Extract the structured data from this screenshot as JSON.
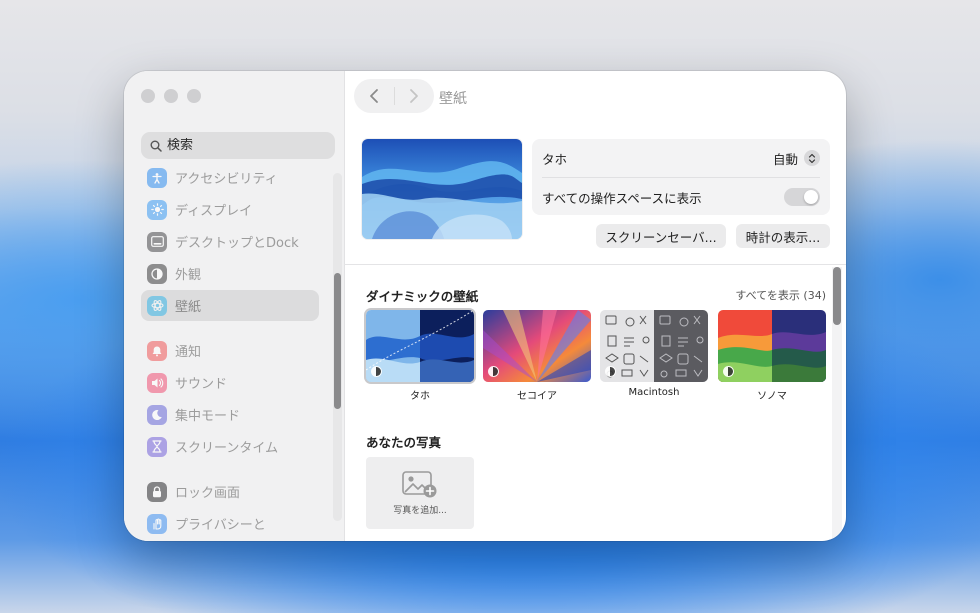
{
  "window": {
    "title": "壁紙"
  },
  "search": {
    "placeholder": "検索"
  },
  "sidebar": {
    "items": [
      {
        "label": "アクセシビリティ",
        "icon": "accessibility-icon",
        "color": "#2f8ef0"
      },
      {
        "label": "ディスプレイ",
        "icon": "display-icon",
        "color": "#3a9af2"
      },
      {
        "label": "デスクトップとDock",
        "icon": "desktop-dock-icon",
        "color": "#3a3a3c"
      },
      {
        "label": "外観",
        "icon": "appearance-icon",
        "color": "#2b2b2d"
      },
      {
        "label": "壁紙",
        "icon": "wallpaper-icon",
        "color": "#37b6e8",
        "selected": true
      },
      {
        "label": "通知",
        "icon": "notifications-icon",
        "color": "#f04a4a"
      },
      {
        "label": "サウンド",
        "icon": "sound-icon",
        "color": "#f0426b"
      },
      {
        "label": "集中モード",
        "icon": "focus-icon",
        "color": "#5b5bd6"
      },
      {
        "label": "スクリーンタイム",
        "icon": "screen-time-icon",
        "color": "#6a55d8"
      },
      {
        "label": "ロック画面",
        "icon": "lock-icon",
        "color": "#2c2c2e"
      },
      {
        "label": "プライバシーと",
        "icon": "privacy-icon",
        "color": "#3d8ff0"
      }
    ]
  },
  "current": {
    "name": "タホ",
    "mode": "自動",
    "show_all_spaces_label": "すべての操作スペースに表示",
    "show_all_spaces": true
  },
  "buttons": {
    "screensaver": "スクリーンセーバ...",
    "clock": "時計の表示..."
  },
  "dynamic": {
    "title": "ダイナミックの壁紙",
    "show_all": "すべてを表示 (34)",
    "items": [
      {
        "name": "タホ",
        "selected": true
      },
      {
        "name": "セコイア"
      },
      {
        "name": "Macintosh"
      },
      {
        "name": "ソノマ"
      }
    ]
  },
  "photos": {
    "title": "あなたの写真",
    "add_label": "写真を追加..."
  }
}
